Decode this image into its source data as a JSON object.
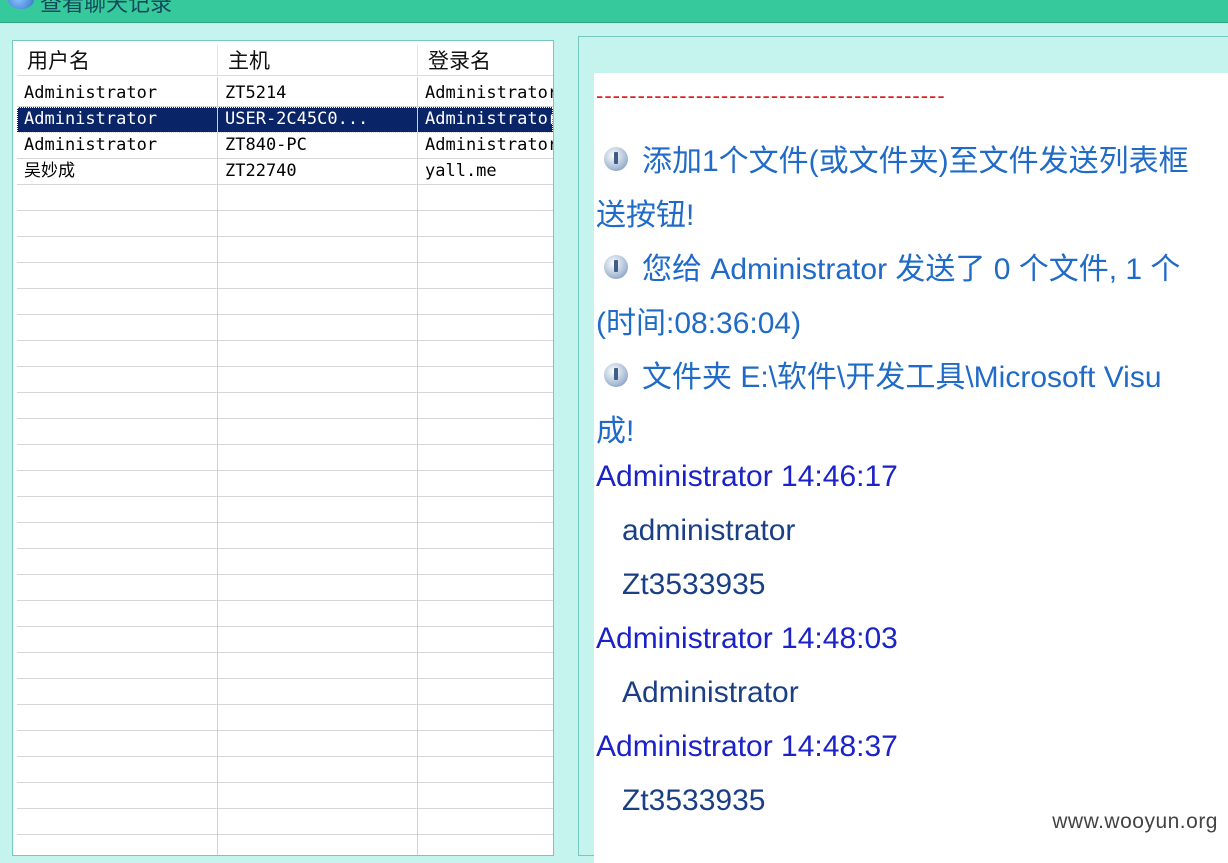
{
  "window": {
    "title": "查看聊天记录"
  },
  "userlist": {
    "columns": [
      "用户名",
      "主机",
      "登录名"
    ],
    "rows": [
      {
        "user": "Administrator",
        "host": "ZT5214",
        "login": "Administrator"
      },
      {
        "user": "Administrator",
        "host": "USER-2C45C0...",
        "login": "Administrator"
      },
      {
        "user": "Administrator",
        "host": "ZT840-PC",
        "login": "Administrator"
      },
      {
        "user": "吴妙成",
        "host": "ZT22740",
        "login": "yall.me"
      }
    ],
    "selected_index": 1
  },
  "chat": {
    "divider": "------------------------------------------",
    "system_messages": [
      {
        "line1": "添加1个文件(或文件夹)至文件发送列表框",
        "line2": "送按钮!"
      },
      {
        "line1": "您给 Administrator 发送了 0 个文件, 1 个",
        "line2": "(时间:08:36:04)"
      },
      {
        "line1": "文件夹 E:\\软件\\开发工具\\Microsoft Visu",
        "line2": "成!"
      }
    ],
    "messages": [
      {
        "header": "Administrator 14:46:17",
        "lines": [
          "administrator",
          "Zt3533935"
        ]
      },
      {
        "header": "Administrator 14:48:03",
        "lines": [
          "Administrator"
        ]
      },
      {
        "header": "Administrator 14:48:37",
        "lines": [
          "Zt3533935"
        ]
      }
    ]
  },
  "watermark": "www.wooyun.org",
  "colors": {
    "titlebar": "#35c99b",
    "panel_bg": "#c5f3ee",
    "selection": "#0a2468",
    "divider": "#e02020",
    "system_text": "#1f6bc7",
    "sender_text": "#1a22c8"
  }
}
